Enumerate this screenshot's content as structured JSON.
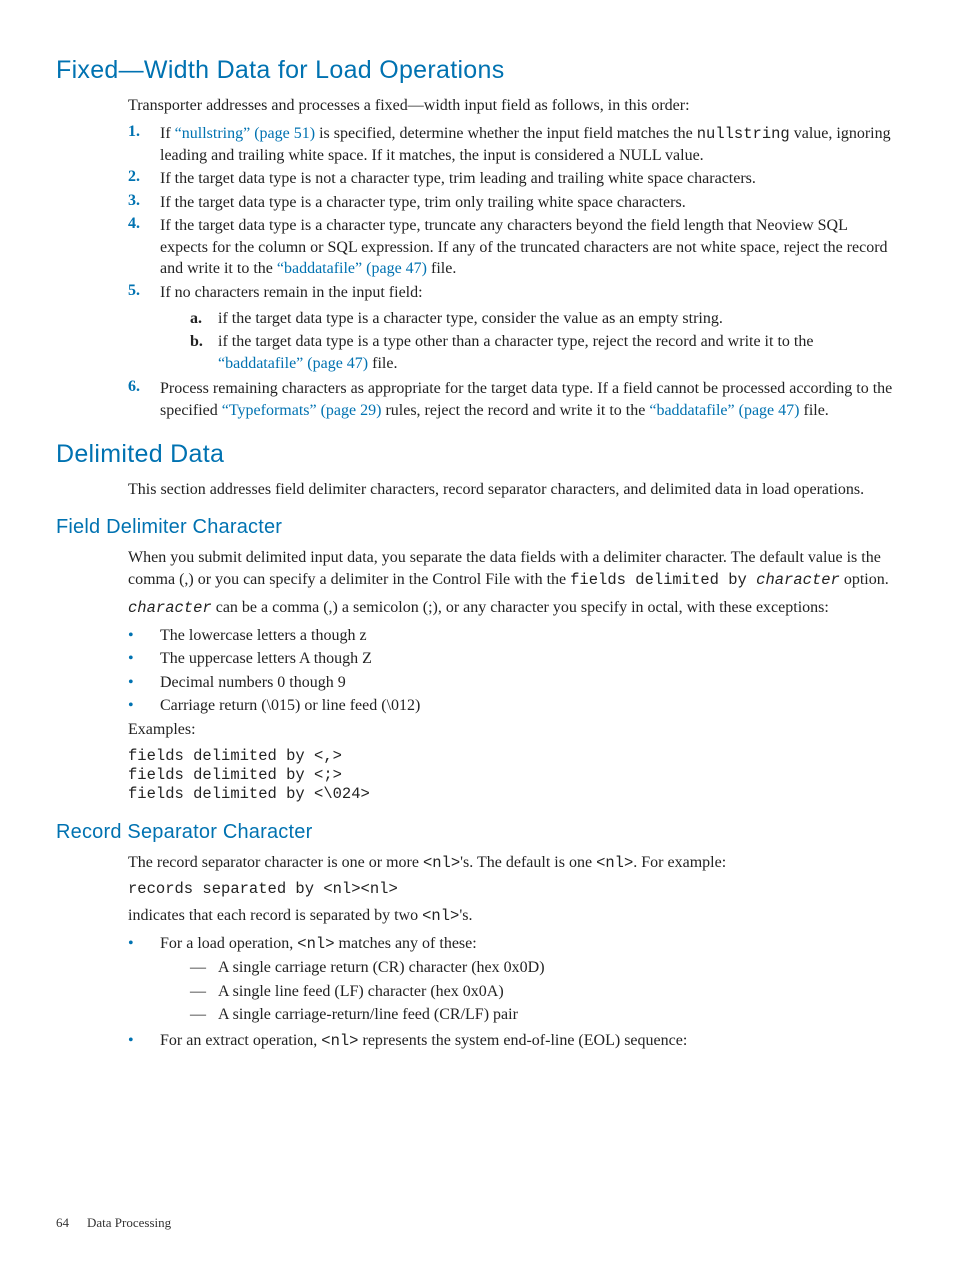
{
  "sect1": {
    "title": "Fixed—Width Data for Load Operations",
    "intro": "Transporter addresses and processes a fixed—width input field as follows, in this order:",
    "items": [
      {
        "n": "1.",
        "pre": "If ",
        "link": "“nullstring” (page 51)",
        "mid": " is specified, determine whether the input field matches the ",
        "code": "nullstring",
        "post": " value, ignoring leading and trailing white space. If it matches, the input is considered a NULL value."
      },
      {
        "n": "2.",
        "text": "If the target data type is not a character type, trim leading and trailing white space characters."
      },
      {
        "n": "3.",
        "text": "If the target data type is a character type, trim only trailing white space characters."
      },
      {
        "n": "4.",
        "text_a": "If the target data type is a character type, truncate any characters beyond the field length that Neoview SQL expects for the column or SQL expression. If any of the truncated characters are not white space, reject the record and write it to the ",
        "link": "“baddatafile” (page 47)",
        "text_b": " file."
      },
      {
        "n": "5.",
        "text": "If no characters remain in the input field:",
        "sub": [
          {
            "n": "a.",
            "text": "if the target data type is a character type, consider the value as an empty string."
          },
          {
            "n": "b.",
            "text_a": "if the target data type is a type other than a character type, reject the record and write it to the ",
            "link": "“baddatafile” (page 47)",
            "text_b": " file."
          }
        ]
      },
      {
        "n": "6.",
        "text_a": "Process remaining characters as appropriate for the target data type. If a field cannot be processed according to the specified ",
        "link": "“Typeformats” (page 29)",
        "text_b": " rules, reject the record and write it to the ",
        "link2": "“baddatafile” (page 47)",
        "text_c": " file."
      }
    ]
  },
  "sect2": {
    "title": "Delimited Data",
    "intro": "This section addresses field delimiter characters, record separator characters, and delimited data in load operations."
  },
  "sect3": {
    "title": "Field Delimiter Character",
    "p1_a": "When you submit delimited input data, you separate the data fields with a delimiter character. The default value is the comma (,) or you can specify a delimiter in the Control File with the ",
    "p1_code1": "fields delimited by ",
    "p1_code2": "character",
    "p1_b": " option.",
    "p2_code": "character",
    "p2_text": " can be a comma (,) a semicolon (;), or any character you specify in octal, with these exceptions:",
    "bullets": [
      "The lowercase letters a though z",
      "The uppercase letters A though Z",
      "Decimal numbers 0 though 9",
      "Carriage return (\\015) or line feed (\\012)"
    ],
    "examples_label": "Examples:",
    "examples_code": "fields delimited by <,>\nfields delimited by <;>\nfields delimited by <\\024>"
  },
  "sect4": {
    "title": "Record Separator Character",
    "p1_a": "The record separator character is one or more ",
    "p1_c1": "<nl>",
    "p1_b": "'s. The default is one ",
    "p1_c2": "<nl>",
    "p1_c": ". For example:",
    "code1": "records separated by <nl><nl>",
    "p2_a": "indicates that each record is separated by two ",
    "p2_c": "<nl>",
    "p2_b": "'s.",
    "b1_a": "For a load operation, ",
    "b1_c": "<nl>",
    "b1_b": " matches any of these:",
    "b1_sub": [
      "A single carriage return (CR) character (hex 0x0D)",
      "A single line feed (LF) character (hex 0x0A)",
      "A single carriage-return/line feed (CR/LF) pair"
    ],
    "b2_a": "For an extract operation, ",
    "b2_c": "<nl>",
    "b2_b": " represents the system end-of-line (EOL) sequence:"
  },
  "footer": {
    "page": "64",
    "chapter": "Data Processing"
  }
}
